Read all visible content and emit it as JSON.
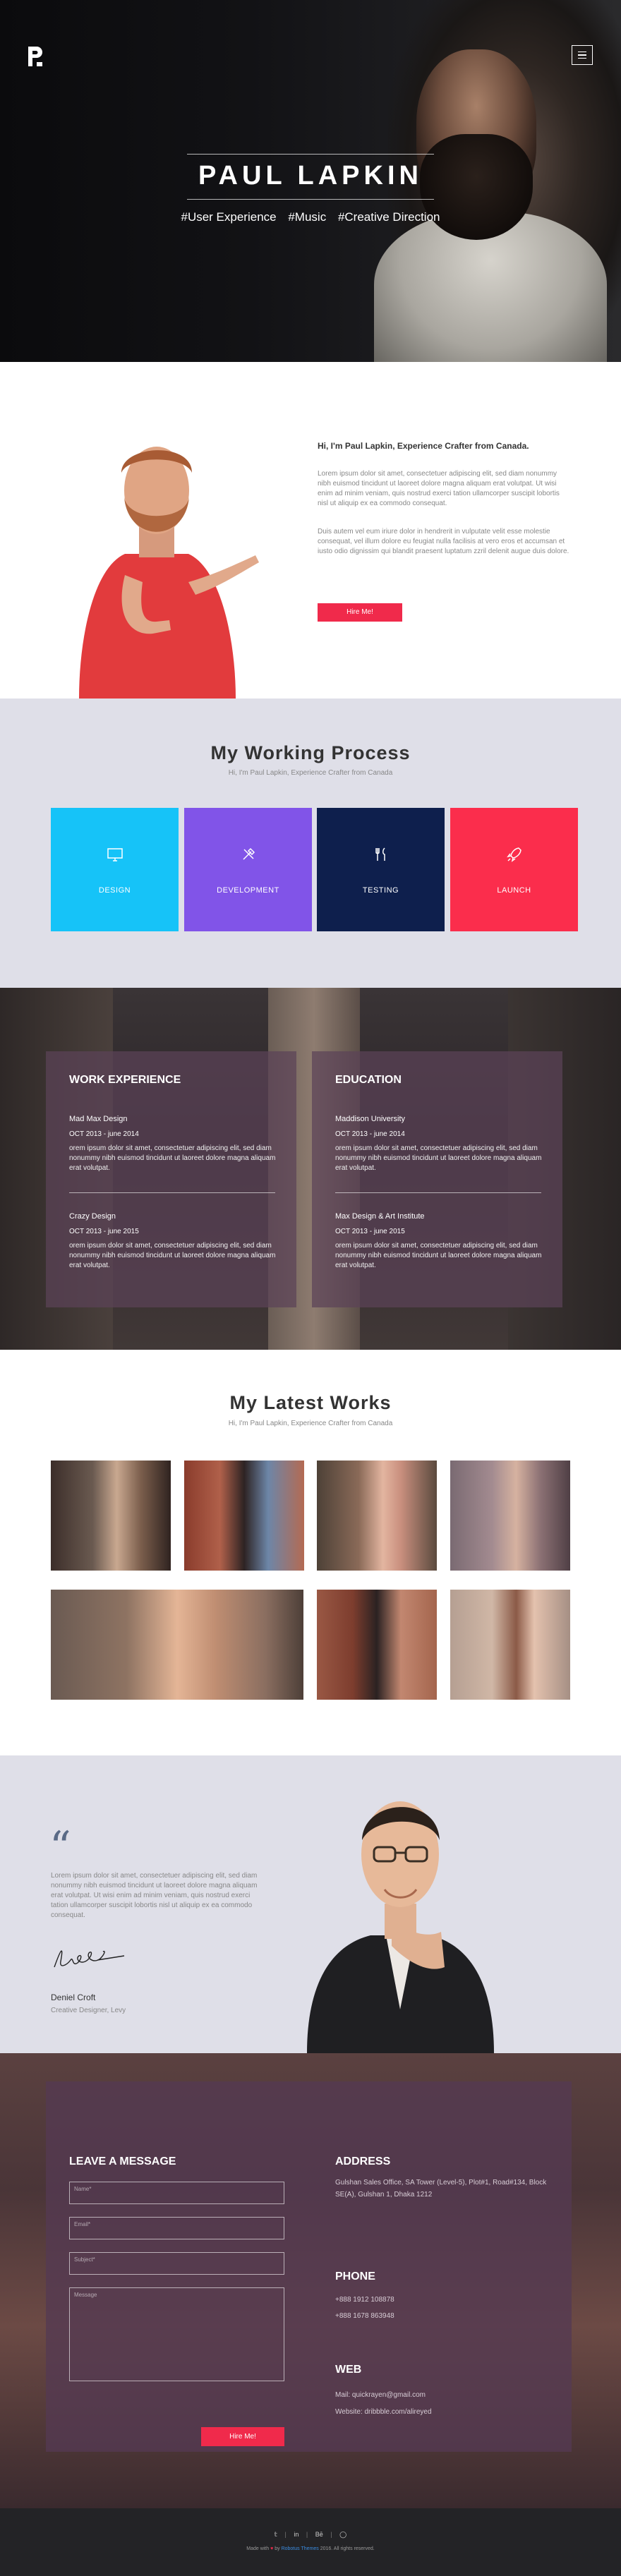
{
  "hero": {
    "title": "PAUL LAPKIN",
    "tags": [
      "#User Experience",
      "#Music",
      "#Creative Direction"
    ]
  },
  "about": {
    "heading": "Hi, I'm Paul Lapkin, Experience Crafter from Canada.",
    "p1": "Lorem ipsum dolor sit amet, consectetuer adipiscing elit, sed diam nonummy nibh euismod tincidunt ut laoreet dolore magna aliquam erat volutpat. Ut wisi enim ad minim veniam, quis nostrud exerci tation ullamcorper suscipit lobortis nisl ut aliquip ex ea commodo consequat.",
    "p2": "Duis autem vel eum iriure dolor in hendrerit in vulputate velit esse molestie consequat, vel illum dolore eu feugiat nulla facilisis at vero eros et accumsan et iusto odio dignissim qui blandit praesent luptatum zzril delenit augue duis dolore.",
    "button": "Hire Me!"
  },
  "process": {
    "title": "My Working Process",
    "subtitle": "Hi, I'm Paul Lapkin, Experience Crafter from Canada",
    "tiles": [
      {
        "label": "DESIGN",
        "icon": "monitor-icon",
        "color": "#16c3f8"
      },
      {
        "label": "DEVELOPMENT",
        "icon": "tools-icon",
        "color": "#8154e8"
      },
      {
        "label": "TESTING",
        "icon": "utensils-icon",
        "color": "#0e1f4d"
      },
      {
        "label": "LAUNCH",
        "icon": "rocket-icon",
        "color": "#fb2d4c"
      }
    ]
  },
  "experience": {
    "work_title": "WORK EXPERIENCE",
    "education_title": "EDUCATION",
    "work": [
      {
        "title": "Mad Max Design",
        "dates": "OCT 2013 - june 2014",
        "text": "orem ipsum dolor sit amet, consectetuer adipiscing elit, sed diam nonummy nibh euismod tincidunt ut laoreet dolore magna aliquam erat volutpat."
      },
      {
        "title": "Crazy Design",
        "dates": "OCT 2013 - june 2015",
        "text": "orem ipsum dolor sit amet, consectetuer adipiscing elit, sed diam nonummy nibh euismod tincidunt ut laoreet dolore magna aliquam erat volutpat."
      }
    ],
    "education": [
      {
        "title": "Maddison University",
        "dates": "OCT 2013 - june 2014",
        "text": "orem ipsum dolor sit amet, consectetuer adipiscing elit, sed diam nonummy nibh euismod tincidunt ut laoreet dolore magna aliquam erat volutpat."
      },
      {
        "title": "Max Design & Art Institute",
        "dates": "OCT 2013 - june 2015",
        "text": "orem ipsum dolor sit amet, consectetuer adipiscing elit, sed diam nonummy nibh euismod tincidunt ut laoreet dolore magna aliquam erat volutpat."
      }
    ]
  },
  "works": {
    "title": "My Latest Works",
    "subtitle": "Hi, I'm Paul Lapkin, Experience Crafter from Canada"
  },
  "testimonial": {
    "text": "Lorem ipsum dolor sit amet, consectetuer adipiscing elit, sed diam nonummy nibh euismod tincidunt ut laoreet dolore magna aliquam erat volutpat. Ut wisi enim ad minim veniam, quis nostrud exerci tation ullamcorper suscipit lobortis nisl ut aliquip ex ea commodo consequat.",
    "name": "Deniel Croft",
    "role": "Creative Designer, Levy"
  },
  "contact": {
    "form_title": "LEAVE A MESSAGE",
    "name_placeholder": "Name*",
    "email_placeholder": "Email*",
    "subject_placeholder": "Subject*",
    "message_placeholder": "Message",
    "button": "Hire Me!",
    "address_title": "ADDRESS",
    "address": "Gulshan Sales Office, SA Tower (Level-5), Plot#1, Road#134, Block SE(A), Gulshan 1, Dhaka 1212",
    "phone_title": "PHONE",
    "phone1": "+888 1912 108878",
    "phone2": "+888 1678 863948",
    "web_title": "WEB",
    "mail": "Mail: quickrayen@gmail.com",
    "website": "Website: dribbble.com/alireyed"
  },
  "footer": {
    "social": [
      "twitter-icon",
      "linkedin-icon",
      "behance-icon",
      "instagram-icon"
    ],
    "made_with": "Made with",
    "by": "by",
    "brand": "Robotus Themes",
    "rights": "2016. All rights reserved."
  }
}
